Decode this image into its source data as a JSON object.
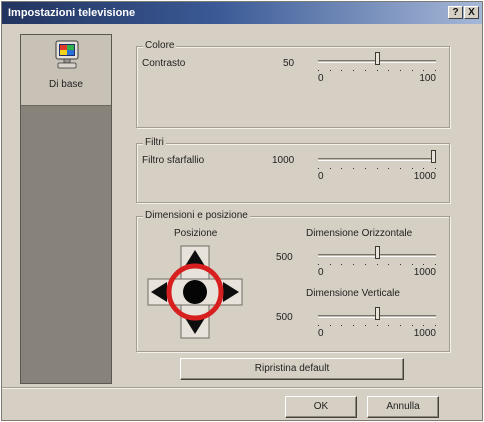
{
  "window": {
    "title": "Impostazioni televisione",
    "help_glyph": "?",
    "close_glyph": "X"
  },
  "sidebar": {
    "items": [
      {
        "label": "Di base",
        "icon": "monitor-icon",
        "selected": true
      }
    ]
  },
  "groups": {
    "color": {
      "title": "Colore",
      "contrast_label": "Contrasto",
      "contrast_value": "50",
      "min": "0",
      "max": "100",
      "level": 0.5
    },
    "filters": {
      "title": "Filtri",
      "flicker_label": "Filtro sfarfallio",
      "flicker_value": "1000",
      "min": "0",
      "max": "1000",
      "level": 1.0
    },
    "size_position": {
      "title": "Dimensioni e posizione",
      "position_label": "Posizione",
      "horizontal_label": "Dimensione Orizzontale",
      "horizontal_value": "500",
      "horizontal_min": "0",
      "horizontal_max": "1000",
      "horizontal_level": 0.5,
      "vertical_label": "Dimensione Verticale",
      "vertical_value": "500",
      "vertical_min": "0",
      "vertical_max": "1000",
      "vertical_level": 0.5
    }
  },
  "buttons": {
    "restore": "Ripristina default",
    "ok": "OK",
    "cancel": "Annulla"
  },
  "colors": {
    "title_start": "#22345f",
    "title_end": "#a6b8d8",
    "highlight_ring": "#d81f1f",
    "dialog_face": "#d6d0c4"
  }
}
